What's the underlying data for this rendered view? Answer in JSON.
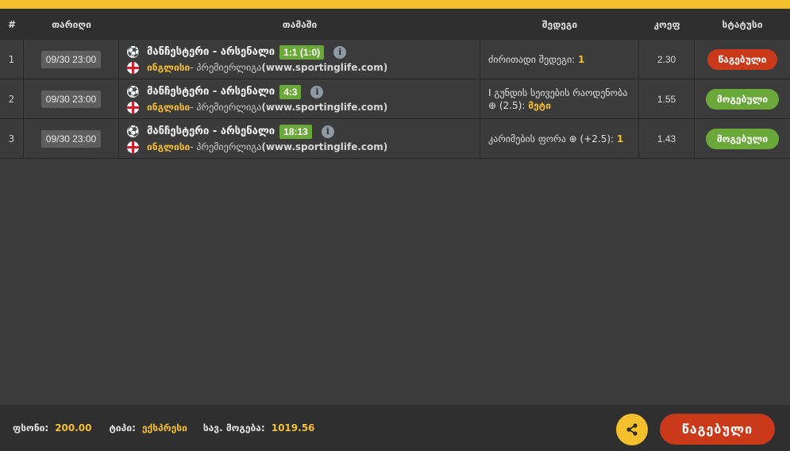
{
  "header": {
    "num": "#",
    "date": "თარიღი",
    "event": "თამაში",
    "outcome": "შედეგი",
    "odds": "კოეფ",
    "status": "სტატუსი"
  },
  "rows": [
    {
      "num": "1",
      "date": "09/30 23:00",
      "match": "მანჩესტერი - არსენალი",
      "score": "1:1 (1:0)",
      "country": "ინგლისი",
      "league_prefix": " - პრემიერლიგა ",
      "league_source": "(www.sportinglife.com)",
      "outcome_label": "ძირითადი შედეგი: ",
      "outcome_value": "1",
      "odds": "2.30",
      "status": "წაგებული",
      "status_type": "lost"
    },
    {
      "num": "2",
      "date": "09/30 23:00",
      "match": "მანჩესტერი - არსენალი",
      "score": "4:3",
      "country": "ინგლისი",
      "league_prefix": " - პრემიერლიგა ",
      "league_source": "(www.sportinglife.com)",
      "outcome_label": "I გუნდის სეივების რაოდენობა ⊕ (2.5): ",
      "outcome_value": "მეტი",
      "odds": "1.55",
      "status": "მოგებული",
      "status_type": "won"
    },
    {
      "num": "3",
      "date": "09/30 23:00",
      "match": "მანჩესტერი - არსენალი",
      "score": "18:13",
      "country": "ინგლისი",
      "league_prefix": " - პრემიერლიგა ",
      "league_source": "(www.sportinglife.com)",
      "outcome_label": "კარიმების ფორა ⊕ (+2.5): ",
      "outcome_value": "1",
      "odds": "1.43",
      "status": "მოგებული",
      "status_type": "won"
    }
  ],
  "footer": {
    "stake_label": "ფსონი:",
    "stake_value": "200.00",
    "type_label": "ტიპი:",
    "type_value": "ექსპრესი",
    "win_label": "სავ. მოგება:",
    "win_value": "1019.56",
    "final_status": "წაგებული"
  },
  "icons": {
    "sport": "soccer-ball-icon",
    "flag": "england-flag-icon",
    "info": "info-icon",
    "share": "share-icon"
  },
  "colors": {
    "accent": "#f5c02b",
    "won": "#6aa83a",
    "lost": "#c9391a"
  }
}
